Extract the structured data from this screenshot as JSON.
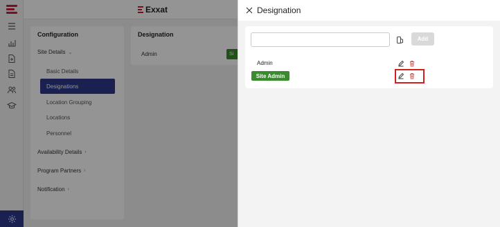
{
  "app": {
    "brand": "Exxat",
    "brand_color": "#c81e3a",
    "nav_active_color": "#2e3a8c"
  },
  "rail": {
    "icons": [
      "menu-icon",
      "chart-icon",
      "add-document-icon",
      "document-icon",
      "users-icon",
      "graduation-cap-icon"
    ],
    "bottom_icon": "settings-icon"
  },
  "config": {
    "title": "Configuration",
    "site_details": "Site Details",
    "sub_items": [
      "Basic Details",
      "Designations",
      "Location Grouping",
      "Locations",
      "Personnel"
    ],
    "active_sub": "Designations",
    "sections": [
      "Availability Details",
      "Program Partners",
      "Notification"
    ]
  },
  "background_designation": {
    "title": "Designation",
    "row": "Admin",
    "badge_fragment": "Si"
  },
  "drawer": {
    "title": "Designation",
    "input_value": "",
    "add_label": "Add",
    "rows": [
      {
        "label": "Admin",
        "is_badge": false
      },
      {
        "label": "Site Admin",
        "is_badge": true
      }
    ],
    "badge_color": "#3a8a2e",
    "delete_color": "#d9534f",
    "highlight_color": "#d11f1f"
  }
}
